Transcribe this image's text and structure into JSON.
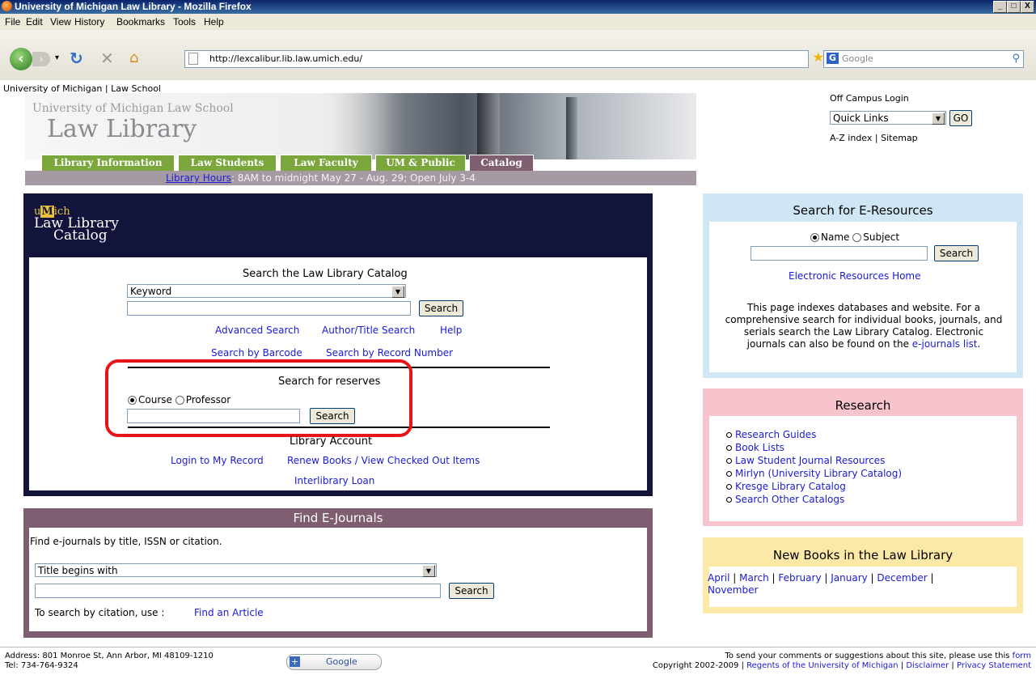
{
  "window": {
    "title": "University of Michigan Law Library - Mozilla Firefox",
    "controls": [
      "_",
      "□",
      "X"
    ]
  },
  "menu": [
    "File",
    "Edit",
    "View",
    "History",
    "Bookmarks",
    "Tools",
    "Help"
  ],
  "browser": {
    "url": "http://lexcalibur.lib.law.umich.edu/",
    "search_placeholder": "Google",
    "search_engine_letter": "G"
  },
  "site": {
    "breadcrumb": "University of Michigan | Law School",
    "school_name": "University of Michigan Law School",
    "library_name": "Law Library",
    "tabs": [
      "Library Information",
      "Law Students",
      "Law Faculty",
      "UM & Public",
      "Catalog"
    ],
    "hours_link": "Library Hours",
    "hours_text": ": 8AM to midnight May 27 - Aug. 29; Open July 3-4",
    "off_campus": "Off Campus Login",
    "quick_links": "Quick Links",
    "go_label": "GO",
    "az_index": "A-Z index",
    "sep": "|",
    "sitemap": "Sitemap"
  },
  "catalog": {
    "logo_u": "u",
    "logo_m": "M",
    "logo_ich": "ich",
    "logo_line2": "Law Library",
    "logo_line3": "Catalog",
    "heading": "Search the Law Library Catalog",
    "search_type": "Keyword",
    "search_button": "Search",
    "links_row1": [
      "Advanced Search",
      "Author/Title Search",
      "Help"
    ],
    "links_row2": [
      "Search by Barcode",
      "Search by Record Number"
    ],
    "reserves_heading": "Search for reserves",
    "reserves_option1": "Course",
    "reserves_option2": "Professor",
    "account_heading": "Library Account",
    "account_links": [
      "Login to My Record",
      "Renew Books / View Checked Out Items"
    ],
    "ill_link": "Interlibrary Loan"
  },
  "ejournals": {
    "title": "Find E-Journals",
    "intro": "Find e-journals by title, ISSN or citation.",
    "match_type": "Title begins with",
    "search_button": "Search",
    "citation_text": "To search by citation, use :",
    "citation_link": "Find an Article"
  },
  "eresources": {
    "title": "Search for E-Resources",
    "option1": "Name",
    "option2": "Subject",
    "search_button": "Search",
    "home_link": "Electronic Resources Home",
    "description": "This page indexes databases and website. For a comprehensive search for individual books, journals, and serials search the Law Library Catalog. Electronic journals can also be found on the",
    "ejournals_link": "e-journals list",
    "period": "."
  },
  "research": {
    "title": "Research",
    "items": [
      "Research Guides",
      "Book Lists",
      "Law Student Journal Resources",
      "Mirlyn (University Library Catalog)",
      "Kresge Library Catalog",
      "Search Other Catalogs"
    ]
  },
  "newbooks": {
    "title": "New Books in the Law Library",
    "months": [
      "April",
      "March",
      "February",
      "January",
      "December",
      "November"
    ]
  },
  "footer": {
    "address": "Address: 801 Monroe St, Ann Arbor, MI 48109-1210",
    "tel": "Tel: 734-764-9324",
    "google_label": "Google",
    "comments": "To send your comments or suggestions about this site, please use this",
    "form_link": "form",
    "copyright": "Copyright 2002-2009 |",
    "regents_link": "Regents of the University of Michigan",
    "disclaimer_link": "Disclaimer",
    "privacy_link": "Privacy Statement"
  }
}
